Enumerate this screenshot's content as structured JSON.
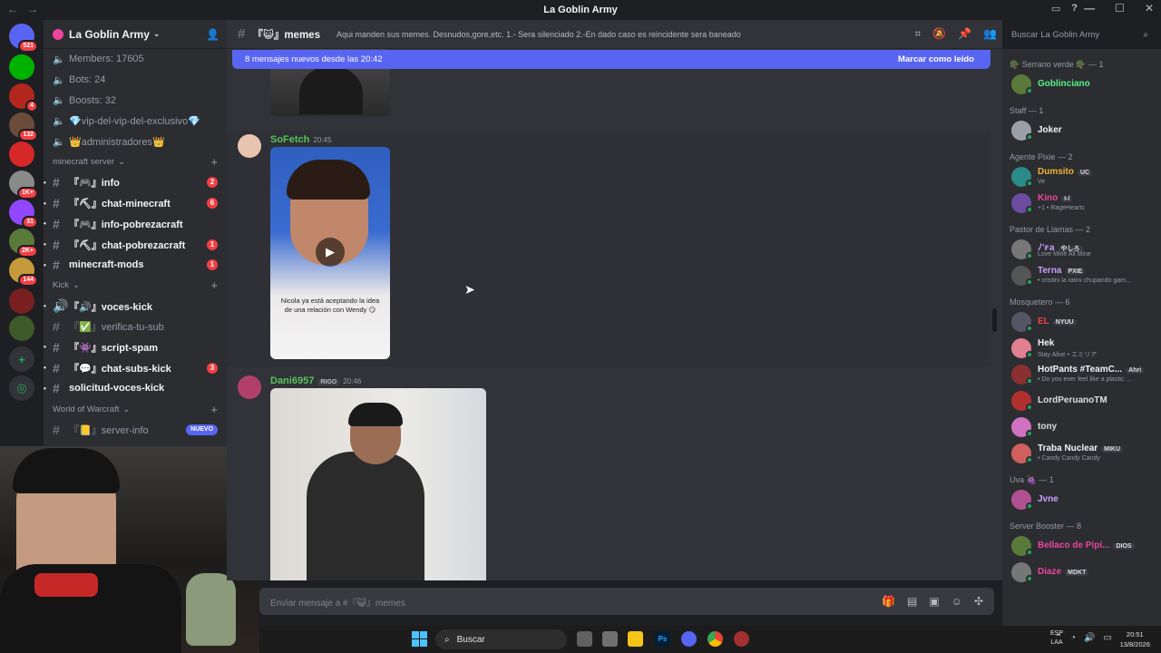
{
  "window": {
    "title": "La Goblin Army"
  },
  "guilds": [
    {
      "badge": "521",
      "color": "#5865f2"
    },
    {
      "badge": "",
      "color": "#00b200"
    },
    {
      "badge": "4",
      "color": "#b3261e"
    },
    {
      "badge": "132",
      "color": "#6b4c3b"
    },
    {
      "badge": "",
      "color": "#d62828"
    },
    {
      "badge": "1K+",
      "color": "#8a8a8a"
    },
    {
      "badge": "31",
      "color": "#9146ff"
    },
    {
      "badge": "2K+",
      "color": "#5a7a3a"
    },
    {
      "badge": "144",
      "color": "#c49a3c"
    },
    {
      "badge": "",
      "color": "#7a1f1f"
    },
    {
      "badge": "",
      "color": "#3d5a2a"
    }
  ],
  "server": {
    "name": "La Goblin Army",
    "stats": [
      {
        "label": "Members: 17605"
      },
      {
        "label": "Bots: 24"
      },
      {
        "label": "Boosts: 32"
      },
      {
        "label": "💎vip-del-vip-del-exclusivo💎"
      },
      {
        "label": "👑administradores👑"
      }
    ],
    "categories": [
      {
        "name": "minecraft server",
        "channels": [
          {
            "name": "『🎮』info",
            "type": "text",
            "badge": "2",
            "bold": true
          },
          {
            "name": "『⛏』chat-minecraft",
            "type": "text",
            "badge": "6",
            "bold": true
          },
          {
            "name": "『🎮』info-pobrezacraft",
            "type": "text",
            "badge": "",
            "bold": true
          },
          {
            "name": "『⛏』chat-pobrezacraft",
            "type": "text",
            "badge": "1",
            "bold": true
          },
          {
            "name": "minecraft-mods",
            "type": "text",
            "badge": "1",
            "bold": true
          }
        ]
      },
      {
        "name": "Kick",
        "channels": [
          {
            "name": "『🔊』voces-kick",
            "type": "voice",
            "badge": "",
            "bold": true
          },
          {
            "name": "『✅』verifica-tu-sub",
            "type": "text",
            "badge": "",
            "bold": false
          },
          {
            "name": "『👾』script-spam",
            "type": "text",
            "badge": "",
            "bold": true
          },
          {
            "name": "『💬』chat-subs-kick",
            "type": "text",
            "badge": "3",
            "bold": true
          },
          {
            "name": "solicitud-voces-kick",
            "type": "text",
            "badge": "",
            "bold": true
          }
        ]
      },
      {
        "name": "World of Warcraft",
        "channels": [
          {
            "name": "『📒』server-info",
            "type": "text",
            "badge": "NUEVO",
            "bold": false
          }
        ]
      }
    ]
  },
  "channel": {
    "name": "『😺』memes",
    "topic": "Aqui manden sus memes. Desnudos,gore,etc. 1.- Sera silenciado 2.-En dado caso es reincidente sera baneado"
  },
  "search": {
    "placeholder": "Buscar La Goblin Army"
  },
  "new_messages": {
    "text": "8 mensajes nuevos desde las 20:42",
    "action": "Marcar como leído"
  },
  "messages": [
    {
      "author": "SoFetch",
      "time": "20:45",
      "role": "",
      "caption": "Nicola ya está aceptando la idea de una relación con Wendy 😏",
      "color": "#57c35a"
    },
    {
      "author": "Dani6957",
      "time": "20:46",
      "role": "RIGO",
      "caption": "",
      "color": "#57c35a"
    }
  ],
  "composer": {
    "placeholder": "Enviar mensaje a #『😺』memes"
  },
  "members": [
    {
      "category": "🪖 Serrano verde 🪖 — 1",
      "list": [
        {
          "name": "Goblinciano",
          "status": "",
          "tag": "",
          "color": "#57f287",
          "avcolor": "#5a7a3a"
        }
      ]
    },
    {
      "category": "Staff — 1",
      "list": [
        {
          "name": "Joker",
          "status": "",
          "tag": "",
          "color": "#f2f3f5",
          "avcolor": "#9aa0a6"
        }
      ]
    },
    {
      "category": "Agente Pixie — 2",
      "list": [
        {
          "name": "Dumsito",
          "status": "Ve",
          "tag": "UC",
          "color": "#f0b232",
          "avcolor": "#2b8a8a"
        },
        {
          "name": "Kino",
          "status": "+1 • RageHearts",
          "tag": "I-/",
          "color": "#eb459e",
          "avcolor": "#6b4ca0"
        }
      ]
    },
    {
      "category": "Pastor de Llamas — 2",
      "list": [
        {
          "name": "ﾉ'ꜰa",
          "status": "Love Mine All Mine",
          "tag": "やしろ",
          "color": "#c9a0ff",
          "avcolor": "#777"
        },
        {
          "name": "Terna",
          "status": "• cristini la ratini chupando gam...",
          "tag": "PXIE",
          "color": "#c9a0ff",
          "avcolor": "#555"
        }
      ]
    },
    {
      "category": "Mosquetero — 6",
      "list": [
        {
          "name": "EL",
          "status": "",
          "tag": "NYUU",
          "color": "#ed4245",
          "avcolor": "#556"
        },
        {
          "name": "Hek",
          "status": "Stay Alive • エミリア",
          "tag": "",
          "color": "#f2f3f5",
          "avcolor": "#e08090"
        },
        {
          "name": "HotPants #TeamC...",
          "status": "• Do you ever feel like a plastic ...",
          "tag": "Ahri",
          "color": "#f2f3f5",
          "avcolor": "#8a3030"
        },
        {
          "name": "LordPeruanoTM",
          "status": "",
          "tag": "",
          "color": "#dbdee1",
          "avcolor": "#b03030"
        },
        {
          "name": "tony",
          "status": "",
          "tag": "",
          "color": "#dbdee1",
          "avcolor": "#d070c0"
        },
        {
          "name": "Traba Nuclear",
          "status": "• Candy Candy Candy",
          "tag": "MIKU",
          "color": "#f2f3f5",
          "avcolor": "#d06060"
        }
      ]
    },
    {
      "category": "Uva 🍇 — 1",
      "list": [
        {
          "name": "Jvne",
          "status": "",
          "tag": "",
          "color": "#c9a0ff",
          "avcolor": "#b05090"
        }
      ]
    },
    {
      "category": "Server Booster — 8",
      "list": [
        {
          "name": "Bellaco de Pipi...",
          "status": "",
          "tag": "DIOS",
          "color": "#eb459e",
          "avcolor": "#5a7a3a"
        },
        {
          "name": "Diaze",
          "status": "",
          "tag": "MDKT",
          "color": "#eb459e",
          "avcolor": "#777"
        }
      ]
    }
  ],
  "taskbar": {
    "search": "Buscar",
    "lang1": "ESP",
    "lang2": "LAA",
    "time": "20:51",
    "date": "13/8/2026"
  }
}
